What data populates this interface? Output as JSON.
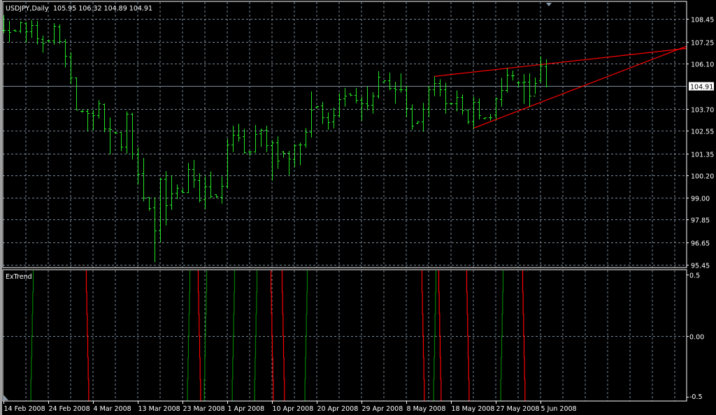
{
  "header": {
    "symbol_timeframe": "USDJPY,Daily",
    "ohlc_text": "105.95 106.32 104.89 104.91"
  },
  "indicator": {
    "name": "ExTrend"
  },
  "colors": {
    "background": "#000000",
    "grid": "#778899",
    "bar_up_down": "#22e622",
    "trendline": "#ff0000",
    "signal_up": "#008000",
    "signal_down": "#ff0000",
    "axis": "#ffffff"
  },
  "chart_data": [
    {
      "type": "ohlc",
      "symbol": "USDJPY",
      "timeframe": "Daily",
      "grid": true,
      "ylim": [
        95.45,
        108.45
      ],
      "y_ticks": [
        "108.45",
        "107.25",
        "106.10",
        "103.70",
        "102.55",
        "101.35",
        "100.20",
        "99.00",
        "97.85",
        "96.65",
        "95.45"
      ],
      "current_price": "104.91",
      "x_tick_labels": [
        "14 Feb 2008",
        "24 Feb 2008",
        "4 Mar 2008",
        "13 Mar 2008",
        "23 Mar 2008",
        "1 Apr 2008",
        "10 Apr 2008",
        "20 Apr 2008",
        "29 Apr 2008",
        "8 May 2008",
        "18 May 2008",
        "27 May 2008",
        "5 Jun 2008"
      ],
      "dates": [
        "2008.02.14",
        "2008.02.15",
        "2008.02.17",
        "2008.02.18",
        "2008.02.19",
        "2008.02.20",
        "2008.02.21",
        "2008.02.22",
        "2008.02.24",
        "2008.02.25",
        "2008.02.26",
        "2008.02.27",
        "2008.02.28",
        "2008.02.29",
        "2008.03.02",
        "2008.03.03",
        "2008.03.04",
        "2008.03.05",
        "2008.03.06",
        "2008.03.07",
        "2008.03.09",
        "2008.03.10",
        "2008.03.11",
        "2008.03.12",
        "2008.03.13",
        "2008.03.14",
        "2008.03.16",
        "2008.03.17",
        "2008.03.18",
        "2008.03.19",
        "2008.03.20",
        "2008.03.21",
        "2008.03.23",
        "2008.03.24",
        "2008.03.25",
        "2008.03.26",
        "2008.03.27",
        "2008.03.28",
        "2008.03.30",
        "2008.03.31",
        "2008.04.01",
        "2008.04.02",
        "2008.04.03",
        "2008.04.04",
        "2008.04.06",
        "2008.04.07",
        "2008.04.08",
        "2008.04.09",
        "2008.04.10",
        "2008.04.11",
        "2008.04.13",
        "2008.04.14",
        "2008.04.15",
        "2008.04.16",
        "2008.04.17",
        "2008.04.18",
        "2008.04.20",
        "2008.04.21",
        "2008.04.22",
        "2008.04.23",
        "2008.04.24",
        "2008.04.25",
        "2008.04.27",
        "2008.04.28",
        "2008.04.29",
        "2008.04.30",
        "2008.05.01",
        "2008.05.02",
        "2008.05.04",
        "2008.05.05",
        "2008.05.06",
        "2008.05.07",
        "2008.05.08",
        "2008.05.09",
        "2008.05.11",
        "2008.05.12",
        "2008.05.13",
        "2008.05.14",
        "2008.05.15",
        "2008.05.16",
        "2008.05.18",
        "2008.05.19",
        "2008.05.20",
        "2008.05.21",
        "2008.05.22",
        "2008.05.23",
        "2008.05.25",
        "2008.05.26",
        "2008.05.27",
        "2008.05.28",
        "2008.05.29",
        "2008.05.30",
        "2008.06.01",
        "2008.06.02",
        "2008.06.03",
        "2008.06.04",
        "2008.06.05",
        "2008.06.06"
      ],
      "ohlc": [
        [
          107.86,
          108.66,
          107.74,
          107.86
        ],
        [
          107.86,
          108.35,
          107.27,
          107.76
        ],
        [
          107.86,
          107.91,
          107.81,
          107.83
        ],
        [
          107.83,
          108.33,
          107.74,
          108.28
        ],
        [
          108.23,
          108.29,
          107.24,
          107.8
        ],
        [
          107.8,
          108.39,
          107.49,
          108.13
        ],
        [
          108.13,
          108.35,
          107.14,
          107.43
        ],
        [
          107.39,
          107.58,
          106.71,
          107.16
        ],
        [
          107.3,
          107.37,
          107.24,
          107.3
        ],
        [
          107.3,
          108.23,
          107.14,
          108.08
        ],
        [
          108.04,
          108.17,
          107.18,
          107.27
        ],
        [
          107.27,
          107.39,
          105.93,
          106.49
        ],
        [
          106.45,
          106.69,
          105.05,
          105.36
        ],
        [
          105.36,
          105.36,
          103.67,
          103.67
        ],
        [
          103.57,
          103.67,
          103.53,
          103.57
        ],
        [
          103.57,
          103.67,
          102.56,
          103.46
        ],
        [
          103.46,
          103.64,
          102.6,
          103.35
        ],
        [
          103.35,
          104.17,
          103.23,
          103.99
        ],
        [
          103.96,
          103.99,
          102.5,
          102.65
        ],
        [
          102.65,
          103.24,
          101.33,
          102.61
        ],
        [
          102.48,
          102.5,
          102.42,
          102.44
        ],
        [
          102.47,
          102.47,
          101.51,
          101.69
        ],
        [
          101.69,
          103.57,
          101.38,
          103.43
        ],
        [
          103.43,
          103.49,
          101.06,
          101.33
        ],
        [
          101.3,
          101.67,
          99.73,
          100.25
        ],
        [
          100.29,
          101.11,
          98.85,
          98.99
        ],
        [
          99.03,
          99.03,
          98.35,
          98.44
        ],
        [
          98.48,
          99.03,
          95.63,
          97.27
        ],
        [
          97.27,
          100.07,
          96.69,
          100.0
        ],
        [
          100.0,
          100.41,
          97.58,
          98.6
        ],
        [
          98.63,
          100.19,
          98.4,
          99.24
        ],
        [
          99.27,
          99.71,
          98.97,
          99.51
        ],
        [
          99.37,
          99.49,
          99.27,
          99.3
        ],
        [
          99.29,
          100.84,
          99.29,
          100.51
        ],
        [
          100.53,
          101.0,
          99.57,
          99.95
        ],
        [
          99.92,
          100.3,
          98.8,
          98.91
        ],
        [
          98.93,
          100.13,
          98.44,
          99.59
        ],
        [
          99.59,
          100.39,
          99.02,
          99.07
        ],
        [
          99.18,
          99.18,
          99.03,
          99.07
        ],
        [
          99.03,
          100.13,
          98.73,
          99.62
        ],
        [
          99.62,
          102.13,
          99.54,
          101.8
        ],
        [
          101.8,
          102.81,
          101.46,
          102.32
        ],
        [
          102.32,
          102.91,
          102.01,
          102.2
        ],
        [
          102.25,
          102.65,
          101.38,
          101.41
        ],
        [
          101.46,
          101.48,
          101.24,
          101.46
        ],
        [
          101.46,
          102.85,
          101.43,
          102.36
        ],
        [
          102.4,
          102.66,
          101.73,
          102.6
        ],
        [
          102.6,
          102.81,
          101.46,
          101.77
        ],
        [
          101.77,
          102.05,
          99.95,
          101.91
        ],
        [
          101.91,
          102.25,
          100.57,
          100.95
        ],
        [
          101.43,
          101.48,
          101.16,
          101.36
        ],
        [
          101.36,
          101.48,
          100.25,
          101.08
        ],
        [
          101.04,
          101.85,
          100.66,
          101.77
        ],
        [
          101.8,
          101.92,
          100.76,
          101.8
        ],
        [
          101.8,
          102.69,
          101.69,
          102.49
        ],
        [
          102.47,
          104.62,
          102.23,
          103.65
        ],
        [
          103.8,
          103.87,
          103.77,
          103.85
        ],
        [
          103.87,
          104.07,
          102.94,
          103.24
        ],
        [
          103.24,
          103.51,
          102.64,
          102.98
        ],
        [
          103.02,
          103.77,
          102.71,
          103.35
        ],
        [
          103.35,
          104.53,
          103.28,
          104.21
        ],
        [
          104.24,
          104.81,
          103.86,
          104.39
        ],
        [
          104.51,
          104.53,
          104.41,
          104.44
        ],
        [
          104.44,
          104.81,
          104.04,
          104.17
        ],
        [
          104.17,
          104.35,
          103.12,
          103.98
        ],
        [
          103.98,
          104.88,
          103.67,
          103.89
        ],
        [
          103.92,
          104.58,
          103.49,
          104.41
        ],
        [
          104.41,
          105.69,
          104.29,
          105.4
        ],
        [
          105.15,
          105.21,
          105.13,
          105.2
        ],
        [
          105.2,
          105.62,
          104.72,
          104.82
        ],
        [
          104.82,
          105.13,
          104.01,
          104.74
        ],
        [
          104.74,
          105.58,
          104.6,
          104.72
        ],
        [
          104.72,
          104.94,
          103.3,
          103.73
        ],
        [
          103.73,
          103.94,
          102.62,
          102.81
        ],
        [
          102.96,
          103.06,
          102.93,
          103.03
        ],
        [
          103.02,
          104.02,
          102.54,
          103.71
        ],
        [
          103.71,
          104.93,
          103.3,
          104.72
        ],
        [
          104.72,
          105.42,
          104.41,
          105.05
        ],
        [
          105.05,
          105.27,
          104.41,
          104.72
        ],
        [
          104.72,
          105.09,
          103.49,
          103.98
        ],
        [
          103.98,
          104.02,
          103.94,
          103.98
        ],
        [
          103.98,
          104.68,
          103.61,
          104.31
        ],
        [
          104.31,
          104.47,
          103.43,
          103.64
        ],
        [
          103.67,
          103.67,
          102.93,
          103.02
        ],
        [
          103.02,
          104.35,
          102.69,
          104.07
        ],
        [
          104.07,
          104.25,
          103.18,
          103.35
        ],
        [
          103.21,
          103.24,
          103.18,
          103.24
        ],
        [
          103.27,
          103.43,
          103.12,
          103.27
        ],
        [
          103.39,
          104.31,
          103.18,
          104.26
        ],
        [
          104.21,
          105.34,
          103.86,
          104.68
        ],
        [
          104.68,
          105.86,
          104.6,
          105.52
        ],
        [
          105.48,
          105.73,
          105.24,
          105.48
        ],
        [
          105.09,
          105.18,
          104.88,
          105.09
        ],
        [
          105.09,
          105.54,
          104.0,
          105.15
        ],
        [
          105.13,
          105.58,
          103.86,
          104.39
        ],
        [
          104.39,
          105.36,
          104.53,
          105.08
        ],
        [
          105.2,
          106.48,
          105.13,
          105.98
        ],
        [
          105.95,
          106.32,
          104.89,
          104.91
        ]
      ],
      "trendlines": [
        {
          "from": {
            "date": "2008.05.14",
            "price": 105.42
          },
          "to_price_at_right_edge": 106.9
        },
        {
          "from": {
            "date": "2008.05.22",
            "price": 102.68
          },
          "to_price_at_right_edge": 107.02
        }
      ]
    },
    {
      "type": "indicator-signals",
      "name": "ExTrend",
      "ylim": [
        -0.5,
        0.5
      ],
      "y_ticks": [
        "0.5",
        "0.00",
        "-0.5"
      ],
      "signals": [
        {
          "date": "2008.02.20",
          "dir": "up"
        },
        {
          "date": "2008.03.03",
          "dir": "down"
        },
        {
          "date": "2008.03.24",
          "dir": "up"
        },
        {
          "date": "2008.03.26",
          "dir": "down"
        },
        {
          "date": "2008.03.27",
          "dir": "up"
        },
        {
          "date": "2008.04.02",
          "dir": "up"
        },
        {
          "date": "2008.04.07",
          "dir": "up"
        },
        {
          "date": "2008.04.10",
          "dir": "down"
        },
        {
          "date": "2008.04.13",
          "dir": "down"
        },
        {
          "date": "2008.04.17",
          "dir": "up"
        },
        {
          "date": "2008.05.12",
          "dir": "down"
        },
        {
          "date": "2008.05.14",
          "dir": "up"
        },
        {
          "date": "2008.05.15",
          "dir": "down"
        },
        {
          "date": "2008.05.21",
          "dir": "down"
        },
        {
          "date": "2008.05.28",
          "dir": "up"
        },
        {
          "date": "2008.06.02",
          "dir": "down"
        }
      ]
    }
  ]
}
